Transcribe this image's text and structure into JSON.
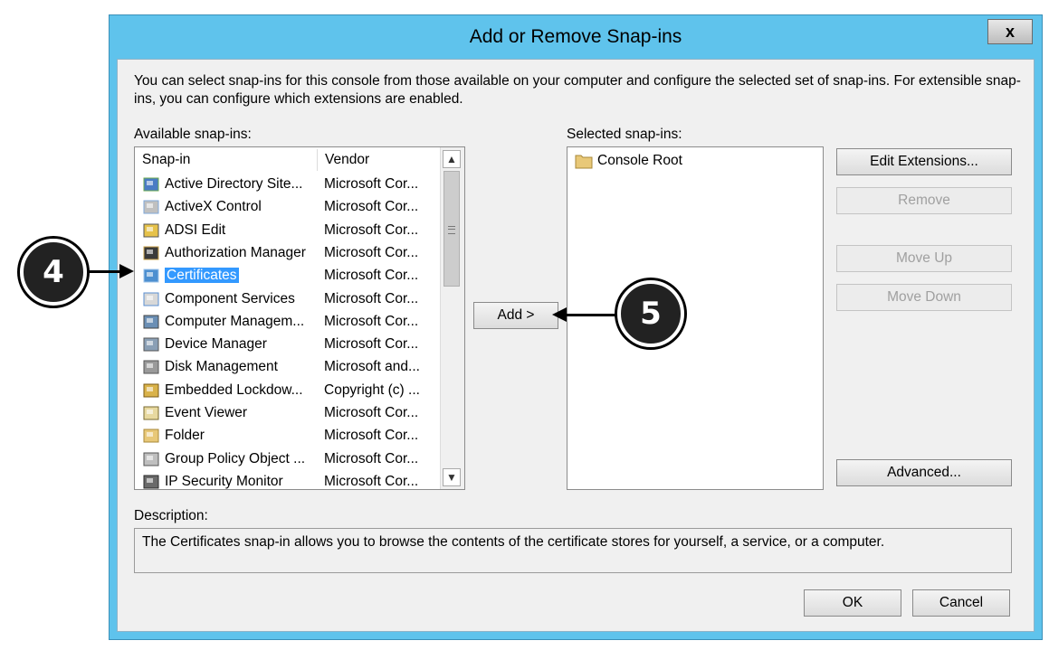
{
  "dialog": {
    "title": "Add or Remove Snap-ins",
    "close_label": "x",
    "intro": "You can select snap-ins for this console from those available on your computer and configure the selected set of snap-ins. For extensible snap-ins, you can configure which extensions are enabled.",
    "available_label": "Available snap-ins:",
    "selected_label": "Selected snap-ins:",
    "columns": {
      "snapin": "Snap-in",
      "vendor": "Vendor"
    },
    "available": [
      {
        "name": "Active Directory Site...",
        "vendor": "Microsoft Cor...",
        "icon": "ad-sites-icon"
      },
      {
        "name": "ActiveX Control",
        "vendor": "Microsoft Cor...",
        "icon": "activex-icon"
      },
      {
        "name": "ADSI Edit",
        "vendor": "Microsoft Cor...",
        "icon": "adsi-edit-icon"
      },
      {
        "name": "Authorization Manager",
        "vendor": "Microsoft Cor...",
        "icon": "authorization-icon"
      },
      {
        "name": "Certificates",
        "vendor": "Microsoft Cor...",
        "icon": "certificates-icon",
        "selected": true
      },
      {
        "name": "Component Services",
        "vendor": "Microsoft Cor...",
        "icon": "component-services-icon"
      },
      {
        "name": "Computer Managem...",
        "vendor": "Microsoft Cor...",
        "icon": "computer-management-icon"
      },
      {
        "name": "Device Manager",
        "vendor": "Microsoft Cor...",
        "icon": "device-manager-icon"
      },
      {
        "name": "Disk Management",
        "vendor": "Microsoft and...",
        "icon": "disk-management-icon"
      },
      {
        "name": "Embedded Lockdow...",
        "vendor": "Copyright (c) ...",
        "icon": "lock-icon"
      },
      {
        "name": "Event Viewer",
        "vendor": "Microsoft Cor...",
        "icon": "event-viewer-icon"
      },
      {
        "name": "Folder",
        "vendor": "Microsoft Cor...",
        "icon": "folder-icon"
      },
      {
        "name": "Group Policy Object ...",
        "vendor": "Microsoft Cor...",
        "icon": "group-policy-icon"
      },
      {
        "name": "IP Security Monitor",
        "vendor": "Microsoft Cor...",
        "icon": "ip-security-icon"
      }
    ],
    "selected": [
      {
        "name": "Console Root",
        "icon": "folder-icon"
      }
    ],
    "buttons": {
      "add": "Add >",
      "edit_extensions": "Edit Extensions...",
      "remove": "Remove",
      "move_up": "Move Up",
      "move_down": "Move Down",
      "advanced": "Advanced...",
      "ok": "OK",
      "cancel": "Cancel"
    },
    "description_label": "Description:",
    "description": "The Certificates snap-in allows you to browse the contents of the certificate stores for yourself, a service, or a computer."
  },
  "callouts": {
    "step4": "4",
    "step5": "5"
  },
  "colors": {
    "frame": "#5fc3ec",
    "selection": "#3399ff",
    "client": "#f0f0f0"
  }
}
